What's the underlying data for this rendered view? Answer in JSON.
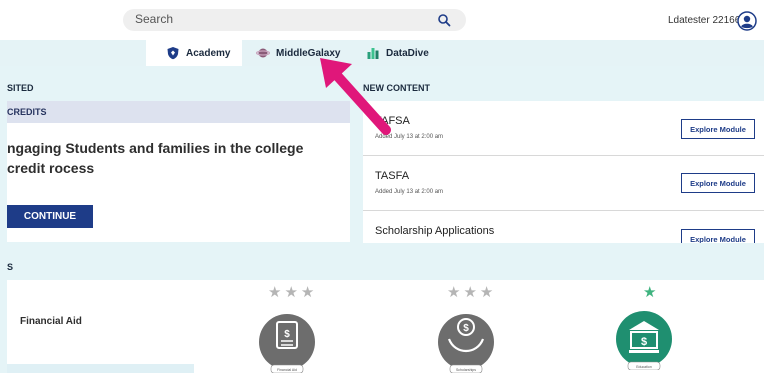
{
  "search": {
    "placeholder": "Search"
  },
  "user": {
    "name": "Ldatester 22166"
  },
  "nav": {
    "tabs": [
      {
        "label": "Academy",
        "icon": "shield-icon",
        "active": true
      },
      {
        "label": "MiddleGalaxy",
        "icon": "planet-icon",
        "active": false
      },
      {
        "label": "DataDive",
        "icon": "chart-icon",
        "active": false
      }
    ]
  },
  "visited": {
    "section_label": "SITED",
    "tag": "CREDITS",
    "title": "ngaging Students and families in the college credit rocess",
    "continue_label": "CONTINUE"
  },
  "new_content": {
    "section_label": "NEW CONTENT",
    "modules": [
      {
        "title": "FAFSA",
        "date": "Added July 13 at 2:00 am",
        "button": "Explore Module"
      },
      {
        "title": "TASFA",
        "date": "Added July 13 at 2:00 am",
        "button": "Explore Module"
      },
      {
        "title": "Scholarship Applications",
        "date": "",
        "button": "Explore Module"
      }
    ]
  },
  "lower": {
    "section_label": "S",
    "item_label": "Financial Aid",
    "badges": [
      {
        "icon": "document-icon",
        "stars_filled": 0,
        "stars_total": 3,
        "caption": "Financial Aid"
      },
      {
        "icon": "scholarship-icon",
        "stars_filled": 0,
        "stars_total": 3,
        "caption": "Scholarships"
      },
      {
        "icon": "bank-icon",
        "stars_filled": 1,
        "stars_total": 1,
        "caption": "Education"
      }
    ]
  },
  "colors": {
    "accent": "#1e3c88",
    "background": "#e5f4f7",
    "annotation_arrow": "#e0177a",
    "star_filled": "#3fb37f",
    "star_empty": "#b5b5b5"
  }
}
